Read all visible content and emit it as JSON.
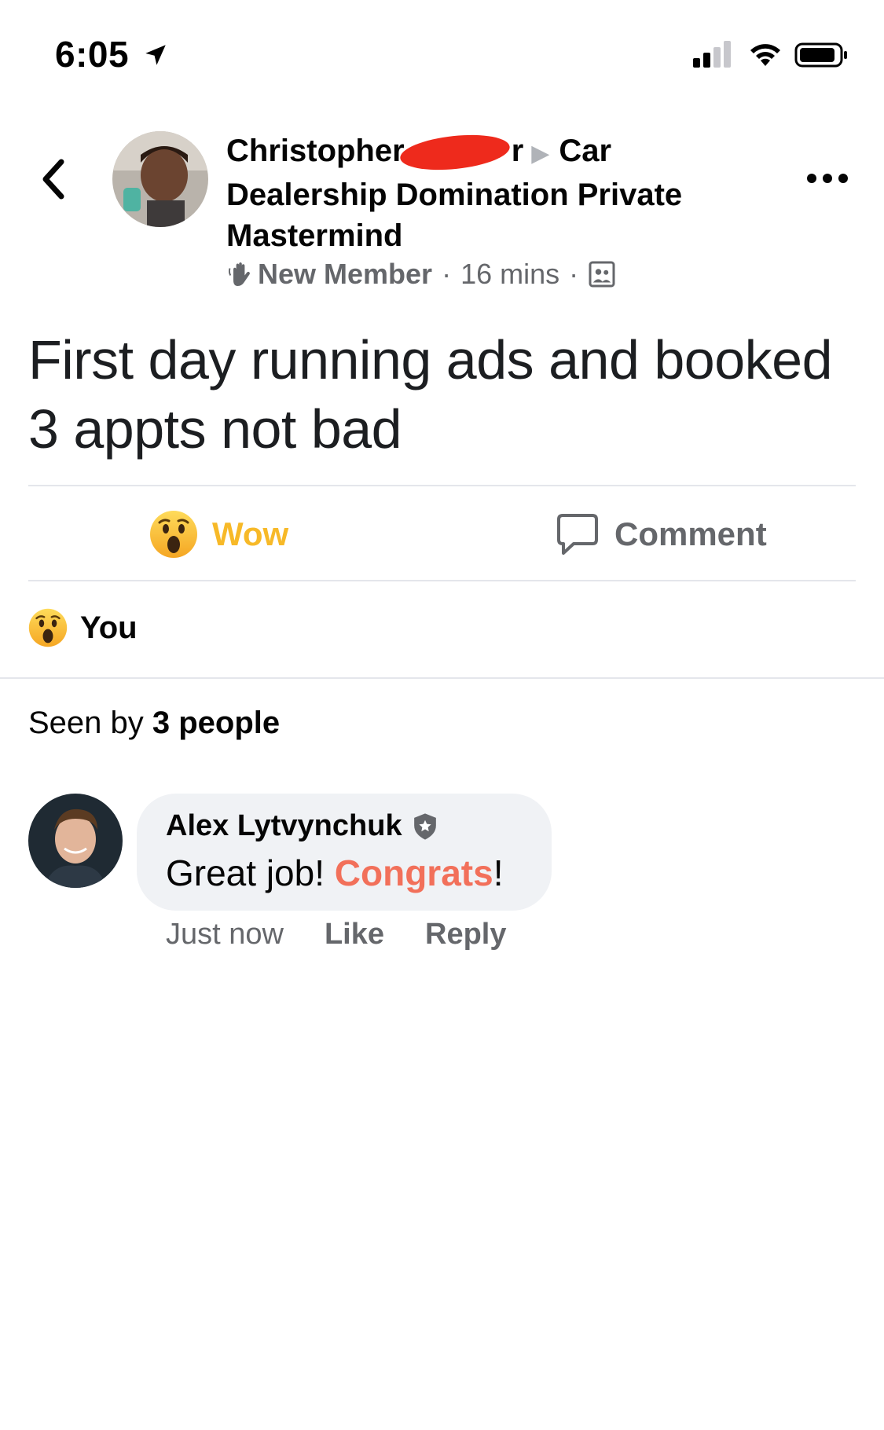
{
  "status_bar": {
    "time": "6:05",
    "icons": [
      "location-arrow-icon",
      "cellular-signal-icon",
      "wifi-icon",
      "battery-icon"
    ]
  },
  "header": {
    "back_icon": "chevron-left-icon",
    "author_first_name": "Christopher",
    "author_name_tail": "r",
    "group_name": "Car Dealership Domination Private Mastermind",
    "badge": "New Member",
    "time_ago": "16 mins",
    "audience_icon": "group-members-icon",
    "more_icon": "more-horizontal-icon"
  },
  "post": {
    "text": "First day running ads and booked 3 appts not bad"
  },
  "actions": {
    "reaction_label": "Wow",
    "comment_label": "Comment"
  },
  "reactions": {
    "summary": "You"
  },
  "seen": {
    "prefix": "Seen by ",
    "count": "3 people"
  },
  "comment": {
    "author": "Alex Lytvynchuk",
    "text_before": "Great job! ",
    "highlight": "Congrats",
    "text_after": "!",
    "time": "Just now",
    "like_label": "Like",
    "reply_label": "Reply"
  },
  "colors": {
    "wow_yellow": "#f7b928",
    "secondary_text": "#65676b",
    "divider": "#e4e6eb",
    "bubble": "#f0f2f5",
    "highlight": "#f2705a",
    "redaction": "#ee2a1c"
  }
}
